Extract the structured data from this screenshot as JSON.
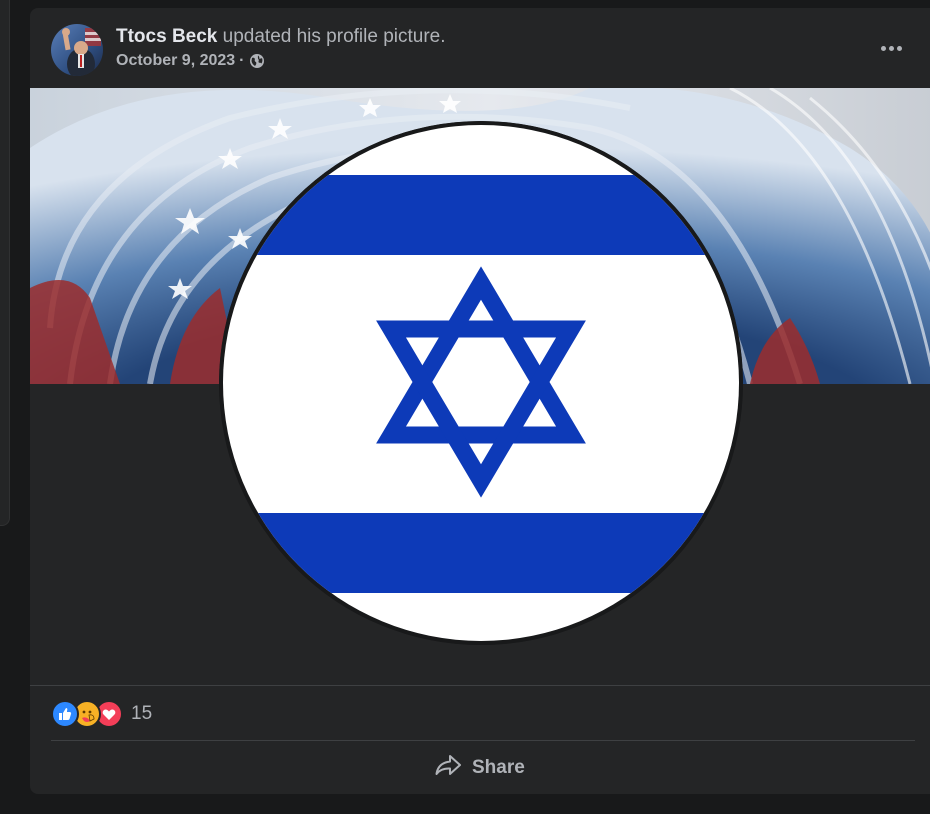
{
  "post": {
    "author": "Ttocs Beck",
    "action": "updated his profile picture.",
    "date": "October 9, 2023",
    "separator": "·",
    "privacy_icon": "globe-icon",
    "more_icon": "more-options-icon"
  },
  "reactions": {
    "types": [
      "like",
      "care",
      "love"
    ],
    "count": "15"
  },
  "actions": {
    "share_label": "Share"
  },
  "colors": {
    "flag_blue": "#0d3ab8",
    "like_blue": "#2d88ff",
    "love_red": "#f33e58",
    "care_yellow": "#f7b125"
  }
}
